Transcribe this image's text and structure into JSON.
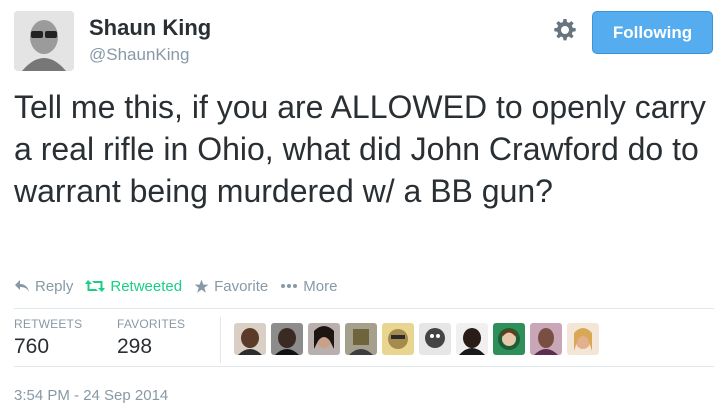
{
  "user": {
    "display_name": "Shaun King",
    "handle": "@ShaunKing",
    "follow_label": "Following"
  },
  "tweet": {
    "text": "Tell me this, if you are ALLOWED to openly carry a real rifle in Ohio, what did John Crawford do to warrant being murdered w/ a BB gun?"
  },
  "actions": {
    "reply": "Reply",
    "retweet": "Retweeted",
    "favorite": "Favorite",
    "more": "More"
  },
  "stats": {
    "retweets_label": "RETWEETS",
    "retweets_value": "760",
    "favorites_label": "FAVORITES",
    "favorites_value": "298"
  },
  "timestamp": "3:54 PM - 24 Sep 2014",
  "colors": {
    "accent": "#55acee",
    "retweeted": "#19cf86",
    "muted": "#8899a6"
  }
}
